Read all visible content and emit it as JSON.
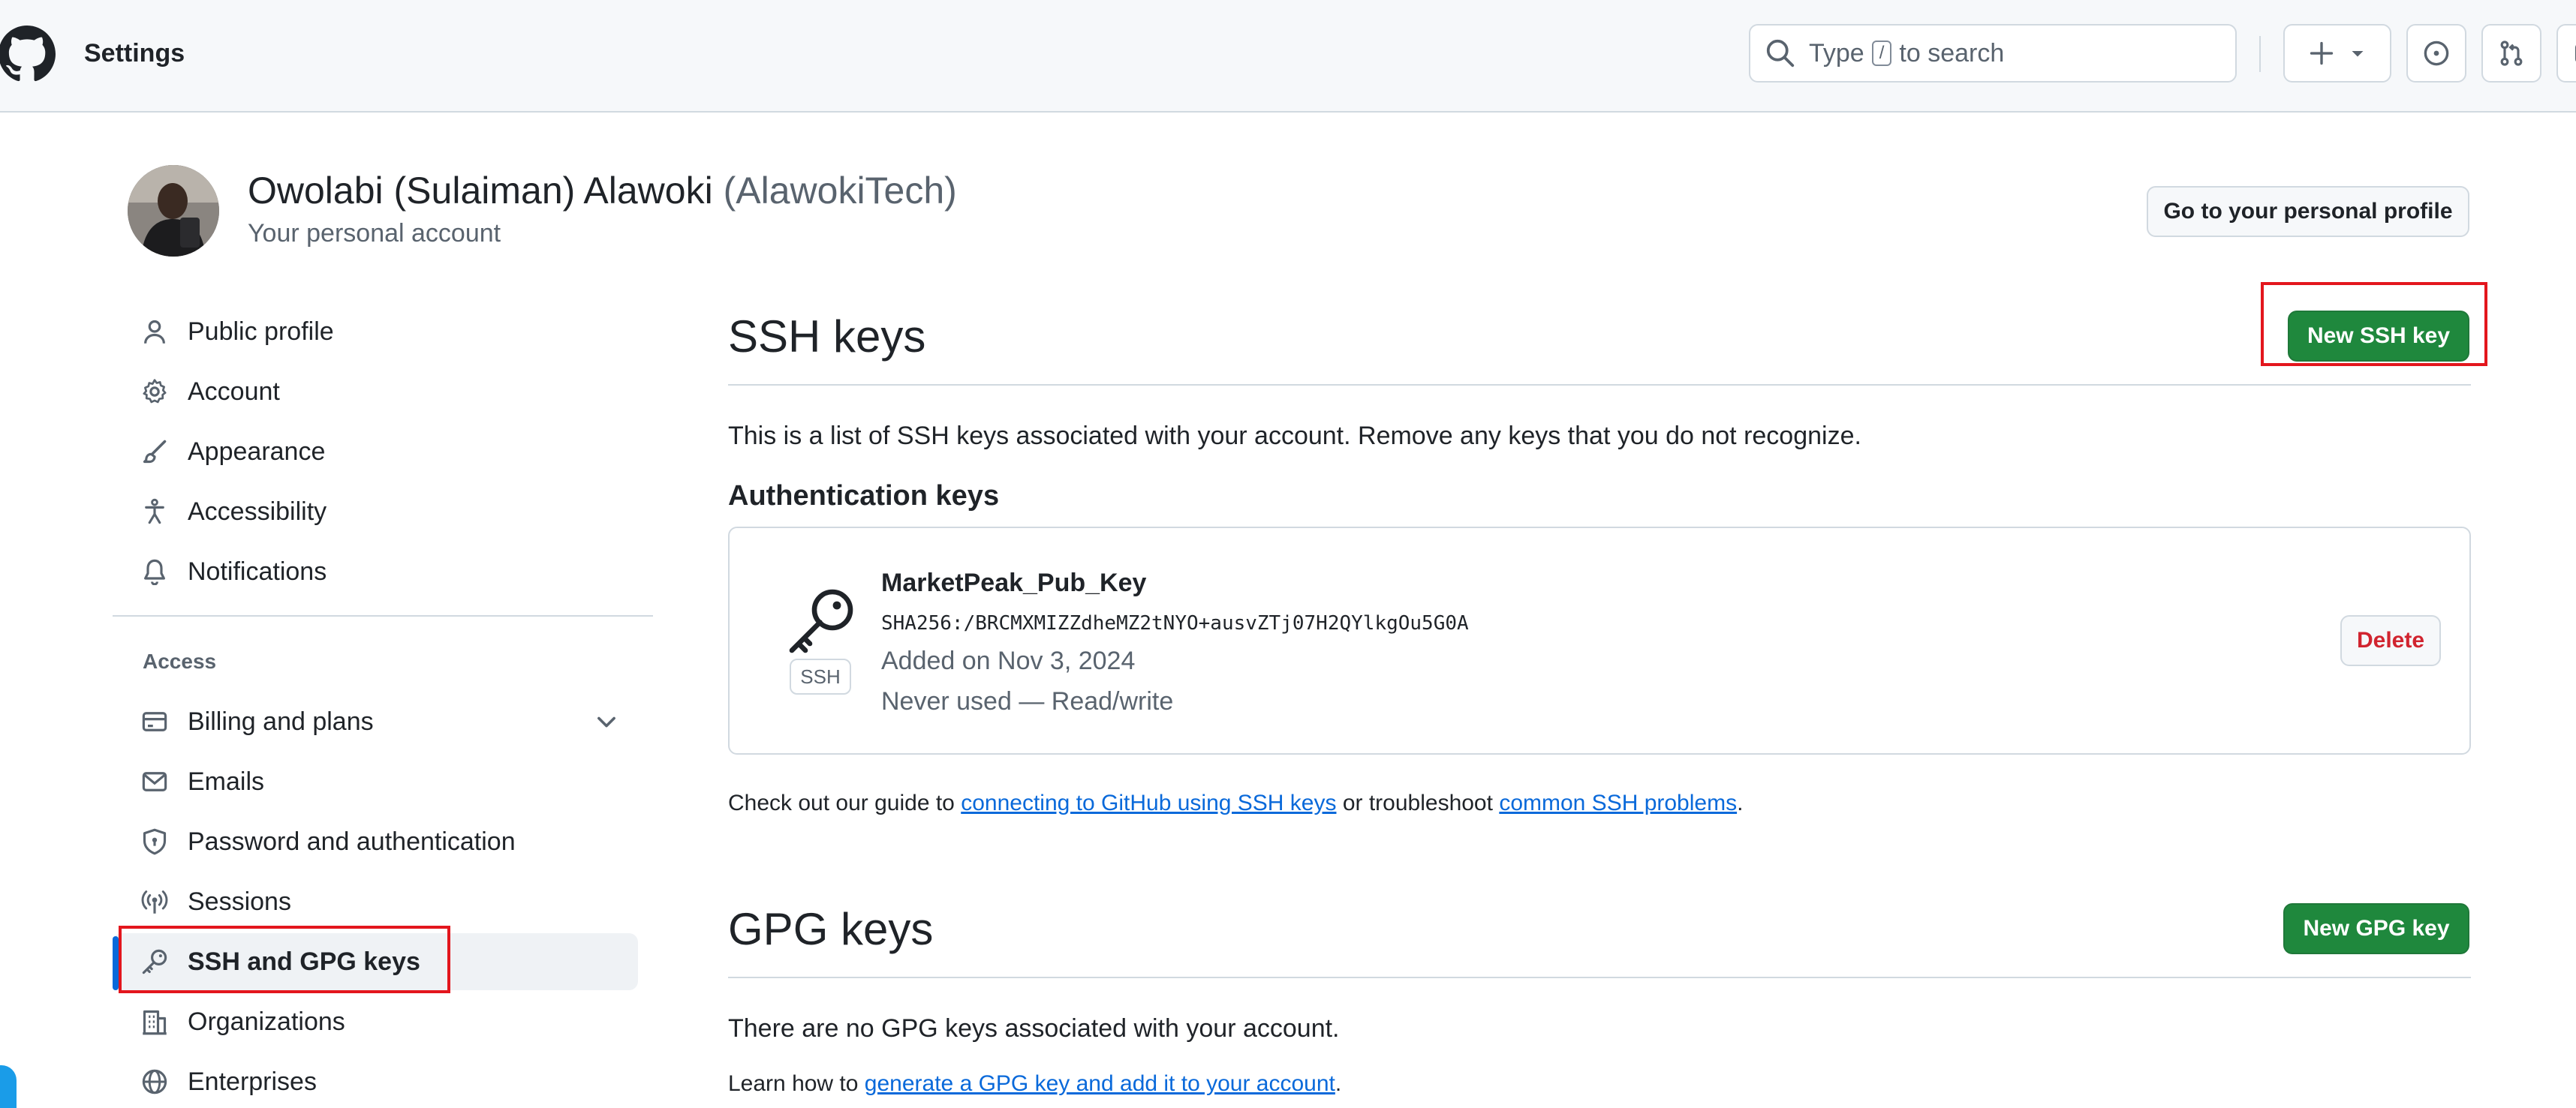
{
  "header": {
    "title": "Settings",
    "search": {
      "prefix": "Type",
      "key": "/",
      "suffix": "to search"
    },
    "icons": {
      "logo": "github-logo",
      "search": "search-icon",
      "create": "plus-icon",
      "issues": "issue-icon",
      "pulls": "pull-request-icon",
      "inbox": "inbox-icon"
    }
  },
  "profile": {
    "name": "Owolabi (Sulaiman) Alawoki",
    "handle": "(AlawokiTech)",
    "subtitle": "Your personal account",
    "profile_button": "Go to your personal profile"
  },
  "sidebar": {
    "items": [
      {
        "label": "Public profile",
        "icon": "person-icon"
      },
      {
        "label": "Account",
        "icon": "gear-icon"
      },
      {
        "label": "Appearance",
        "icon": "paintbrush-icon"
      },
      {
        "label": "Accessibility",
        "icon": "accessibility-icon"
      },
      {
        "label": "Notifications",
        "icon": "bell-icon"
      }
    ],
    "access_heading": "Access",
    "access_items": [
      {
        "label": "Billing and plans",
        "icon": "credit-card-icon",
        "expandable": true
      },
      {
        "label": "Emails",
        "icon": "mail-icon"
      },
      {
        "label": "Password and authentication",
        "icon": "shield-lock-icon"
      },
      {
        "label": "Sessions",
        "icon": "broadcast-icon"
      },
      {
        "label": "SSH and GPG keys",
        "icon": "key-icon",
        "active": true
      },
      {
        "label": "Organizations",
        "icon": "organization-icon"
      },
      {
        "label": "Enterprises",
        "icon": "globe-icon"
      }
    ]
  },
  "ssh": {
    "title": "SSH keys",
    "new_button": "New SSH key",
    "description": "This is a list of SSH keys associated with your account. Remove any keys that you do not recognize.",
    "auth_heading": "Authentication keys",
    "key": {
      "tag": "SSH",
      "title": "MarketPeak_Pub_Key",
      "fingerprint": "SHA256:/BRCMXMIZZdheMZ2tNYO+ausvZTj07H2QYlkgOu5G0A",
      "added": "Added on Nov 3, 2024",
      "usage": "Never used — Read/write",
      "delete_button": "Delete"
    },
    "guide": {
      "prefix": "Check out our guide to",
      "link1": "connecting to GitHub using SSH keys",
      "middle": "or troubleshoot",
      "link2": "common SSH problems",
      "suffix": "."
    }
  },
  "gpg": {
    "title": "GPG keys",
    "new_button": "New GPG key",
    "description": "There are no GPG keys associated with your account.",
    "learn": {
      "prefix": "Learn how to",
      "link": "generate a GPG key and add it to your account",
      "suffix": "."
    }
  },
  "colors": {
    "accent_green": "#1f883d",
    "link_blue": "#0969da",
    "danger_red": "#d1242f",
    "highlight_red": "#e3161d"
  }
}
